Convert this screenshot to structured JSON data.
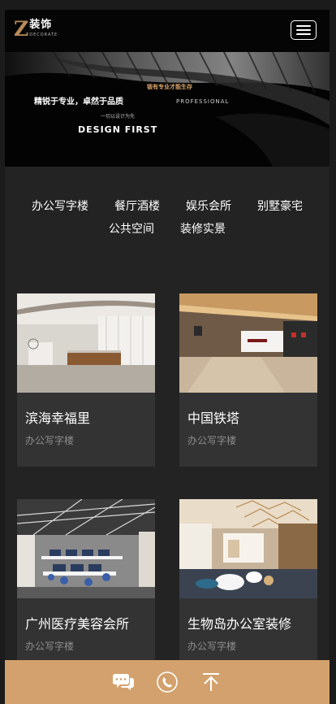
{
  "header": {
    "logo_letter": "Z",
    "logo_name": "装饰",
    "logo_sub": "DECORATE",
    "menu_icon": "hamburger-menu-icon"
  },
  "banner": {
    "slogan": "精锐于专业，卓然于品质",
    "tagline": "锻有专业才能生存",
    "professional": "PROFESSIONAL",
    "small": "一切以设计为先",
    "title": "DESIGN FIRST"
  },
  "categories": [
    {
      "label": "办公写字楼"
    },
    {
      "label": "餐厅酒楼"
    },
    {
      "label": "娱乐会所"
    },
    {
      "label": "别墅豪宅"
    },
    {
      "label": "公共空间"
    },
    {
      "label": "装修实景"
    }
  ],
  "projects": [
    {
      "title": "滨海幸福里",
      "category": "办公写字楼"
    },
    {
      "title": "中国铁塔",
      "category": "办公写字楼"
    },
    {
      "title": "广州医疗美容会所",
      "category": "办公写字楼"
    },
    {
      "title": "生物岛办公室装修",
      "category": "办公写字楼"
    }
  ],
  "bottom_bar": {
    "icons": [
      "chat-icon",
      "phone-icon",
      "back-to-top-icon"
    ],
    "color": "#d3a16d"
  },
  "colors": {
    "accent": "#d3a16d",
    "background": "#232323",
    "card": "#333333"
  }
}
